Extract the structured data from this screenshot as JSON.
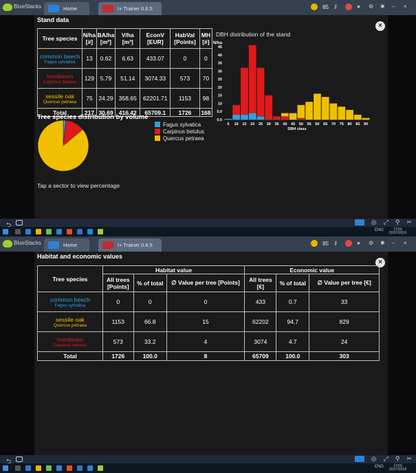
{
  "bluestacks": {
    "app_name": "BlueStacks",
    "tabs": [
      {
        "label": "Home"
      },
      {
        "label": "I+ Trainer 0.6.5"
      }
    ],
    "coins": "85",
    "accent": "#9bd02c"
  },
  "screen1": {
    "panel_title": "Stand data",
    "table": {
      "headers": {
        "species": "Tree species",
        "nha": "N/ha",
        "nha_u": "[#]",
        "baha": "BA/ha",
        "baha_u": "[m²]",
        "vha": "V/ha",
        "vha_u": "[m³]",
        "econ": "EconV",
        "econ_u": "[EUR]",
        "hab": "HabVal",
        "hab_u": "[Points]",
        "mh": "MH",
        "mh_u": "[#]"
      },
      "rows": [
        {
          "common": "common beech",
          "sci": "Fagus sylvatica",
          "nha": "13",
          "baha": "0.62",
          "vha": "6.63",
          "econ": "433.07",
          "hab": "0",
          "mh": "0"
        },
        {
          "common": "hornbeam",
          "sci": "Carpinus betulus",
          "nha": "129",
          "baha": "5.79",
          "vha": "51.14",
          "econ": "3074.33",
          "hab": "573",
          "mh": "70"
        },
        {
          "common": "sessile oak",
          "sci": "Quercus petraea",
          "nha": "75",
          "baha": "24.29",
          "vha": "358.65",
          "econ": "62201.71",
          "hab": "1153",
          "mh": "98"
        }
      ],
      "total": {
        "label": "Total",
        "nha": "217",
        "baha": "30.69",
        "vha": "416.42",
        "econ": "65709.1",
        "hab": "1726",
        "mh": "168"
      }
    },
    "histogram_title": "DBH distribution of the stand",
    "distribution_title": "Tree species distribution by volume",
    "legend": [
      "Fagus sylvatica",
      "Carpinus betulus",
      "Quercus petraea"
    ],
    "tap_hint": "Tap a sector to view percentage"
  },
  "screen2": {
    "panel_title": "Habitat and economic values",
    "groups": {
      "habitat": "Habitat value",
      "economic": "Economic value"
    },
    "headers": {
      "species": "Tree species",
      "all_trees_pts": "All trees [Points]",
      "pct_total": "% of total",
      "val_per_tree_pts": "∅ Value per tree [Points]",
      "all_trees_eur": "All trees [€]",
      "pct_total2": "% of total",
      "val_per_tree_eur": "∅ Value per tree [€]"
    },
    "rows": [
      {
        "common": "common beech",
        "sci": "Fagus sylvatica",
        "hab_all": "0",
        "hab_pct": "0",
        "hab_per": "0",
        "eco_all": "433",
        "eco_pct": "0.7",
        "eco_per": "33"
      },
      {
        "common": "sessile oak",
        "sci": "Quercus petraea",
        "hab_all": "1153",
        "hab_pct": "66.8",
        "hab_per": "15",
        "eco_all": "62202",
        "eco_pct": "94.7",
        "eco_per": "829"
      },
      {
        "common": "hornbeam",
        "sci": "Carpinus betulus",
        "hab_all": "573",
        "hab_pct": "33.2",
        "hab_per": "4",
        "eco_all": "3074",
        "eco_pct": "4.7",
        "eco_per": "24"
      }
    ],
    "total": {
      "label": "Total",
      "hab_all": "1726",
      "hab_pct": "100.0",
      "hab_per": "8",
      "eco_all": "65709",
      "eco_pct": "100.0",
      "eco_per": "303"
    }
  },
  "system": {
    "clock_time": "13:59",
    "clock_date": "02/07/2018",
    "lang": "ENG"
  },
  "chart_data": [
    {
      "type": "bar",
      "title": "DBH distribution of the stand",
      "ylabel": "N/ha",
      "xlabel": "DBH class",
      "categories": [
        "5",
        "10",
        "15",
        "20",
        "25",
        "30",
        "35",
        "40",
        "45",
        "50",
        "55",
        "60",
        "65",
        "70",
        "75",
        "80",
        "85",
        "90"
      ],
      "ylim": [
        0,
        45
      ],
      "yticks": [
        "0.0",
        "5.0",
        "10",
        "15",
        "20",
        "25",
        "30",
        "35",
        "40",
        "45"
      ],
      "stacked": true,
      "series": [
        {
          "name": "Fagus sylvatica",
          "color": "#2ba3e6",
          "values": [
            0.5,
            3,
            3,
            4,
            2,
            0,
            0,
            0,
            0,
            0,
            0,
            0,
            0,
            0,
            0,
            0,
            0,
            0
          ]
        },
        {
          "name": "Carpinus betulus",
          "color": "#e01a1a",
          "values": [
            0,
            6,
            29,
            42,
            30,
            15,
            2,
            2,
            0,
            1,
            0,
            0,
            0,
            0,
            0,
            0,
            0,
            0
          ]
        },
        {
          "name": "Quercus petraea",
          "color": "#f0c000",
          "values": [
            0,
            0,
            0,
            0,
            0,
            0,
            0,
            2,
            4,
            8,
            11,
            16,
            14,
            10,
            8,
            6,
            3,
            1
          ]
        }
      ]
    },
    {
      "type": "pie",
      "title": "Tree species distribution by volume",
      "labels": [
        "Fagus sylvatica",
        "Carpinus betulus",
        "Quercus petraea"
      ],
      "values": [
        6.63,
        51.14,
        358.65
      ],
      "colors": [
        "#2ba3e6",
        "#e01a1a",
        "#f0c000"
      ]
    }
  ]
}
